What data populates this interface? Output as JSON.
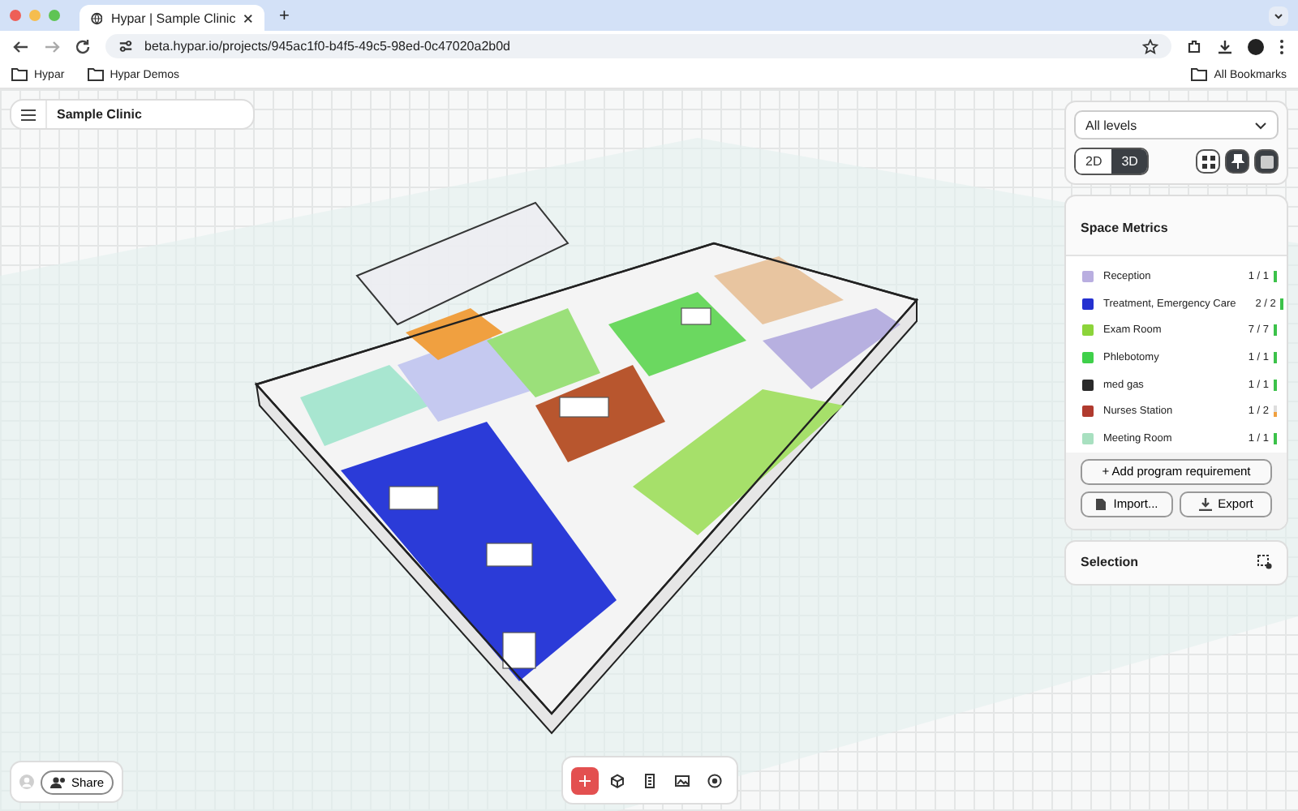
{
  "browser": {
    "tab_title": "Hypar | Sample Clinic",
    "new_tab": "+",
    "url": "beta.hypar.io/projects/945ac1f0-b4f5-49c5-98ed-0c47020a2b0d",
    "bookmarks": [
      "Hypar",
      "Hypar Demos"
    ],
    "all_bookmarks": "All Bookmarks"
  },
  "project": {
    "title": "Sample Clinic"
  },
  "view_panel": {
    "level_select": "All levels",
    "modes": [
      {
        "label": "2D",
        "selected": false
      },
      {
        "label": "3D",
        "selected": true
      }
    ],
    "view_buttons": [
      {
        "kind": "grid",
        "on": false
      },
      {
        "kind": "pin",
        "on": true
      },
      {
        "kind": "square",
        "on": true
      }
    ]
  },
  "space_metrics": {
    "title": "Space Metrics",
    "rows": [
      {
        "name": "Reception",
        "count": "1 / 1",
        "color": "#b9aee0",
        "level": 1
      },
      {
        "name": "Treatment, Emergency Care",
        "count": "2 / 2",
        "color": "#2430d0",
        "level": 1
      },
      {
        "name": "Exam Room",
        "count": "7 / 7",
        "color": "#8cd43a",
        "level": 1
      },
      {
        "name": "Phlebotomy",
        "count": "1 / 1",
        "color": "#3fd04a",
        "level": 1
      },
      {
        "name": "med gas",
        "count": "1 / 1",
        "color": "#2a2a2a",
        "level": 1
      },
      {
        "name": "Nurses Station",
        "count": "1 / 2",
        "color": "#b03a2e",
        "level": 0.5
      },
      {
        "name": "Meeting Room",
        "count": "1 / 1",
        "color": "#a8e0c0",
        "level": 1
      }
    ],
    "add_button": "+ Add program requirement",
    "import_button": "Import...",
    "export_button": "Export"
  },
  "selection": {
    "title": "Selection"
  },
  "share_button": "Share",
  "bottom_toolbar": [
    {
      "kind": "add",
      "selected": true
    },
    {
      "kind": "cube",
      "selected": false
    },
    {
      "kind": "building",
      "selected": false
    },
    {
      "kind": "image",
      "selected": false
    },
    {
      "kind": "target",
      "selected": false
    }
  ]
}
